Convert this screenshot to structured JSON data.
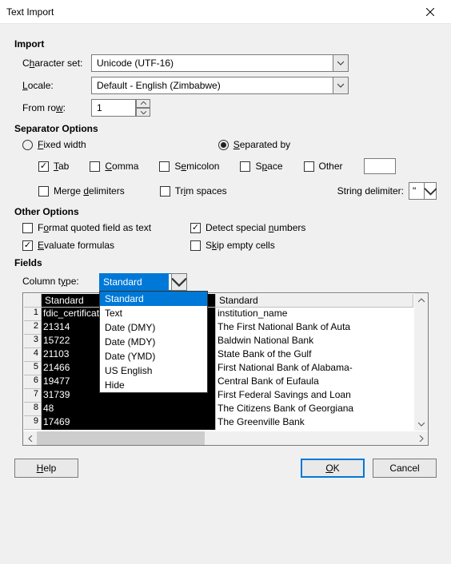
{
  "titlebar": {
    "title": "Text Import"
  },
  "import": {
    "section": "Import",
    "charset_label": "Character set:",
    "charset_u": "h",
    "charset_value": "Unicode (UTF-16)",
    "locale_label": "Locale:",
    "locale_u": "L",
    "locale_value": "Default - English (Zimbabwe)",
    "fromrow_label": "From row:",
    "fromrow_u": "w",
    "fromrow_value": "1"
  },
  "separator": {
    "section": "Separator Options",
    "fixed_label": "Fixed width",
    "fixed_u": "F",
    "sep_label": "Separated by",
    "sep_u": "S",
    "tab_label": "Tab",
    "tab_u": "T",
    "comma_label": "Comma",
    "comma_u": "C",
    "semi_label": "Semicolon",
    "semi_u": "e",
    "space_label": "Space",
    "space_u": "p",
    "other_label": "Other",
    "merge_label": "Merge delimiters",
    "merge_u": "d",
    "trim_label": "Trim spaces",
    "trim_u": "i",
    "strdelim_label": "String delimiter:",
    "strdelim_u": "g",
    "strdelim_value": "\""
  },
  "other": {
    "section": "Other Options",
    "fmt_label": "Format quoted field as text",
    "fmt_u": "o",
    "detect_label": "Detect special numbers",
    "detect_u": "n",
    "eval_label": "Evaluate formulas",
    "eval_u": "E",
    "skip_label": "Skip empty cells",
    "skip_u": "k"
  },
  "fields": {
    "section": "Fields",
    "coltype_label": "Column type:",
    "coltype_u": "y",
    "coltype_value": "Standard",
    "options": [
      "Standard",
      "Text",
      "Date (DMY)",
      "Date (MDY)",
      "Date (YMD)",
      "US English",
      "Hide"
    ],
    "col1_header": "Standard",
    "col2_header": "Standard",
    "rows": [
      {
        "n": "1",
        "a": "fdic_certificate_number",
        "b": "institution_name"
      },
      {
        "n": "2",
        "a": "21314",
        "b": "The First National Bank of Auta"
      },
      {
        "n": "3",
        "a": "15722",
        "b": "Baldwin National Bank"
      },
      {
        "n": "4",
        "a": "21103",
        "b": "State Bank of the Gulf"
      },
      {
        "n": "5",
        "a": "21466",
        "b": "First National Bank of Alabama-"
      },
      {
        "n": "6",
        "a": "19477",
        "b": "Central Bank of Eufaula"
      },
      {
        "n": "7",
        "a": "31739",
        "b": "First Federal Savings and Loan"
      },
      {
        "n": "8",
        "a": "48",
        "b": "The Citizens Bank of Georgiana"
      },
      {
        "n": "9",
        "a": "17469",
        "b": "The Greenville Bank"
      }
    ]
  },
  "footer": {
    "help": "Help",
    "help_u": "H",
    "ok": "OK",
    "ok_u": "O",
    "cancel": "Cancel"
  }
}
